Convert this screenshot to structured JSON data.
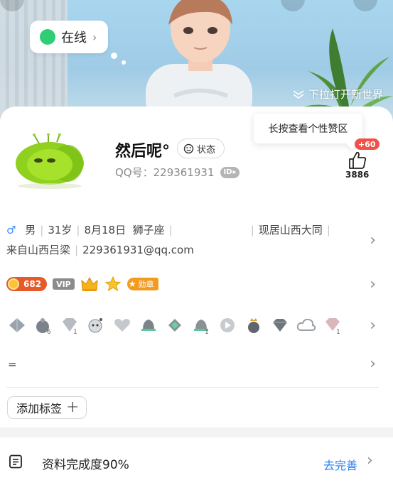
{
  "header": {
    "online_status": "在线",
    "pull_hint": "下拉打开新世界"
  },
  "profile": {
    "nickname": "然后呢°",
    "status_button": "状态",
    "qq_number": "QQ号：229361931",
    "id_badge": "ID"
  },
  "like": {
    "tooltip": "长按查看个性赞区",
    "plus": "+60",
    "count": "3886"
  },
  "info": {
    "gender": "男",
    "age": "31岁",
    "birthday": "8月18日",
    "zodiac": "狮子座",
    "location": "现居山西大同",
    "hometown": "来自山西吕梁",
    "email": "229361931@qq.com"
  },
  "badges": {
    "coin_value": "682",
    "vip": "VIP",
    "medal": "勋章"
  },
  "extra_line": "=",
  "tags": {
    "add_label": "添加标签"
  },
  "completion": {
    "text": "资料完成度90%",
    "action": "去完善"
  },
  "colors": {
    "online_green": "#2fce74",
    "link_blue": "#2b7ff0",
    "like_red": "#f0524a",
    "coin_orange": "#e55a2b",
    "medal_orange": "#f29b1f"
  }
}
